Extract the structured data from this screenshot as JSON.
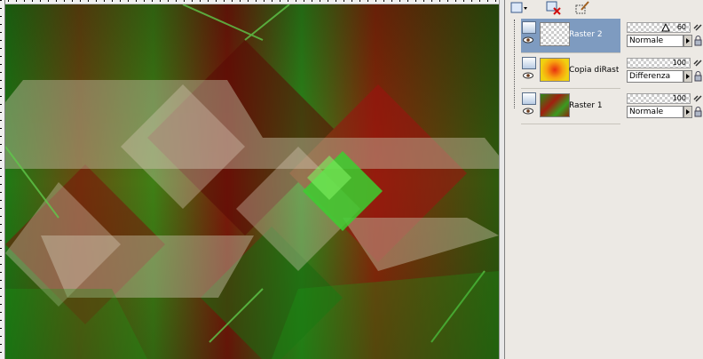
{
  "layers": [
    {
      "name": "Raster 2",
      "opacity": "60",
      "blend": "Normale",
      "selected": true
    },
    {
      "name": "Copia diRast",
      "opacity": "100",
      "blend": "Differenza",
      "selected": false
    },
    {
      "name": "Raster 1",
      "opacity": "100",
      "blend": "Normale",
      "selected": false
    }
  ],
  "colors": {
    "selected_row": "#7e9bc0",
    "panel_bg": "#ece9e4"
  }
}
